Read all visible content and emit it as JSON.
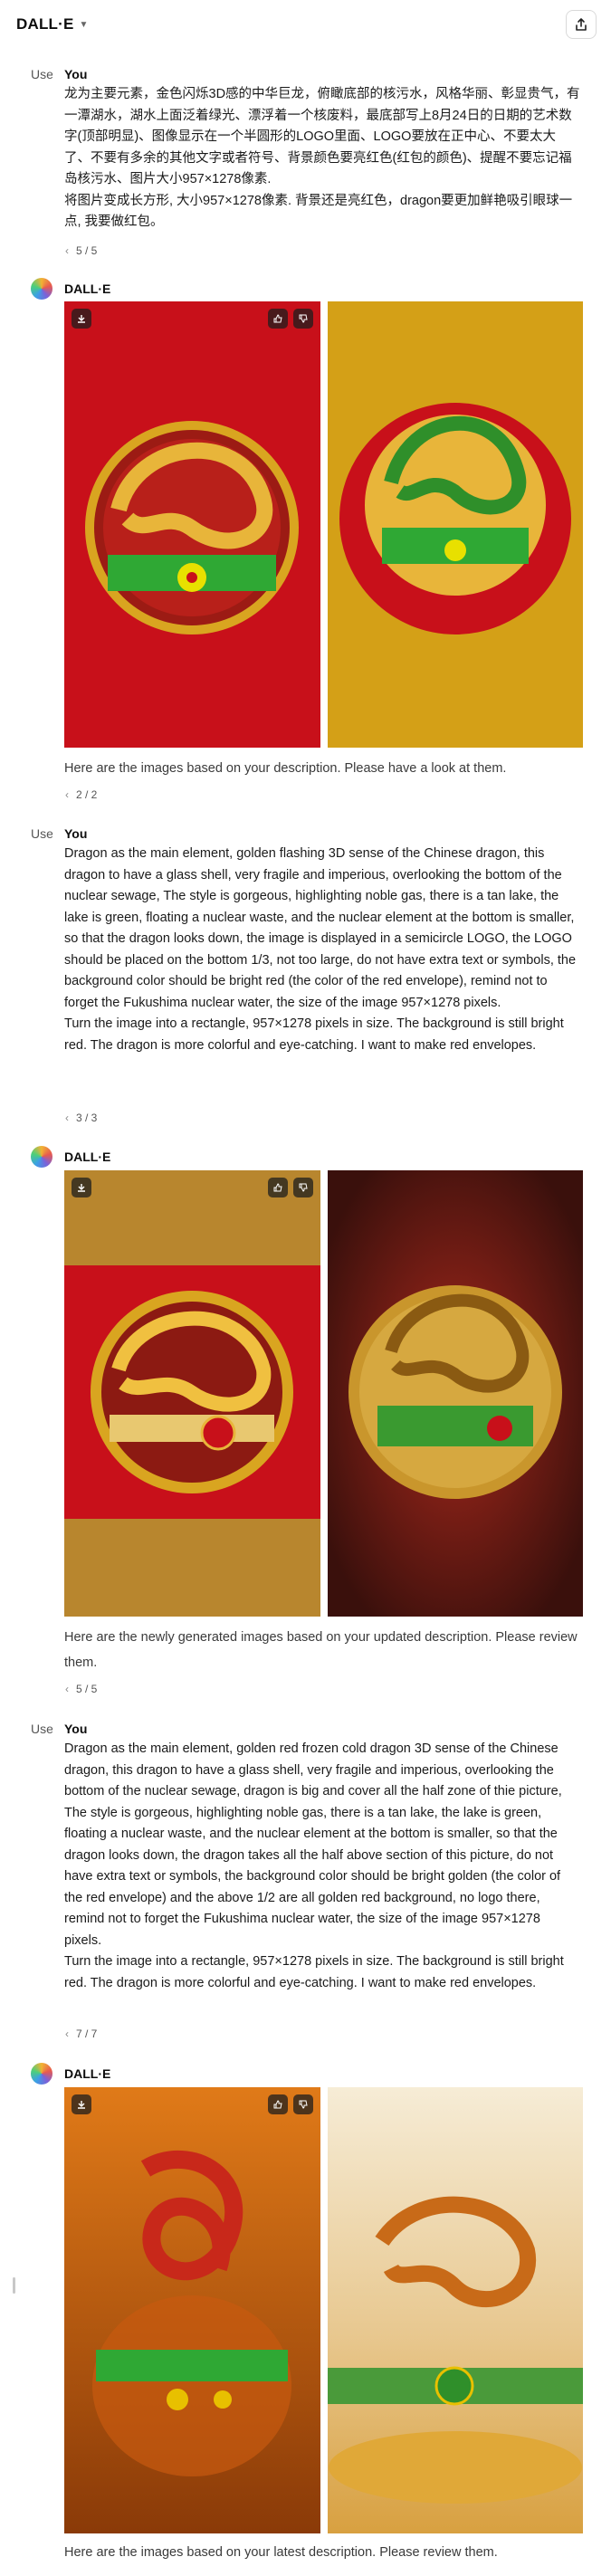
{
  "app": {
    "title": "DALL·E",
    "share_label": "share"
  },
  "messages": [
    {
      "role": "user",
      "avatar": "User",
      "author": "You",
      "paragraphs": [
        "龙为主要元素，金色闪烁3D感的中华巨龙，俯瞰底部的核污水，风格华丽、彰显贵气，有一潭湖水，湖水上面泛着绿光、漂浮着一个核废料，最底部写上8月24日的日期的艺术数字(顶部明显)、图像显示在一个半圆形的LOGO里面、LOGO要放在正中心、不要太大了、不要有多余的其他文字或者符号、背景颜色要亮红色(红包的颜色)、提醒不要忘记福岛核污水、图片大小957×1278像素.",
        "将图片变成长方形, 大小957×1278像素. 背景还是亮红色，dragon要更加鲜艳吸引眼球一点, 我要做红包。"
      ],
      "pager": "5 / 5"
    },
    {
      "role": "assistant",
      "author": "DALL·E",
      "caption": "Here are the images based on your description. Please have a look at them.",
      "pager": "2 / 2"
    },
    {
      "role": "user",
      "avatar": "User",
      "author": "You",
      "paragraphs": [
        "Dragon as the main element, golden flashing 3D sense of the Chinese dragon, this dragon to have a glass shell, very fragile and imperious, overlooking the bottom of the nuclear sewage, The style is gorgeous, highlighting noble gas, there is a tan lake, the lake is green, floating a nuclear waste, and the nuclear element at the bottom is smaller, so that the dragon looks down, the image is displayed in a semicircle LOGO, the LOGO should be placed on the bottom 1/3, not too large, do not have extra text or symbols, the background color should be bright red (the color of the red envelope), remind not to forget the Fukushima nuclear water, the size of the image 957×1278 pixels.",
        "Turn the image into a rectangle, 957×1278 pixels in size. The background is still bright red. The dragon is more colorful and eye-catching. I want to make red envelopes."
      ],
      "pager": "3 / 3"
    },
    {
      "role": "assistant",
      "author": "DALL·E",
      "caption": "Here are the newly generated images based on your updated description. Please review them.",
      "pager": "5 / 5"
    },
    {
      "role": "user",
      "avatar": "User",
      "author": "You",
      "paragraphs": [
        "Dragon as the main element, golden red frozen cold dragon 3D sense of the Chinese dragon, this dragon to have a glass shell, very fragile and imperious, overlooking the bottom of the nuclear sewage, dragon is big and cover all the half zone of thie picture, The style is gorgeous, highlighting noble gas, there is a tan lake, the lake is green, floating a nuclear waste, and the nuclear element at the bottom is smaller, so that the dragon looks down, the dragon takes all the half above section of this picture, do not have extra text or symbols, the background color should be bright golden (the color of the red envelope) and the above 1/2 are all golden red background, no logo there, remind not to forget the Fukushima nuclear water, the size of the image 957×1278 pixels.",
        "Turn the image into a rectangle, 957×1278 pixels in size. The background is still bright red. The dragon is more colorful and eye-catching. I want to make red envelopes."
      ],
      "pager": "7 / 7"
    },
    {
      "role": "assistant",
      "author": "DALL·E",
      "caption": "Here are the images based on your latest description. Please review them."
    }
  ],
  "colors": {
    "red_bg": "#c8101a",
    "gold": "#d9a520",
    "green": "#2fa834",
    "dark_red": "#4a1410"
  }
}
